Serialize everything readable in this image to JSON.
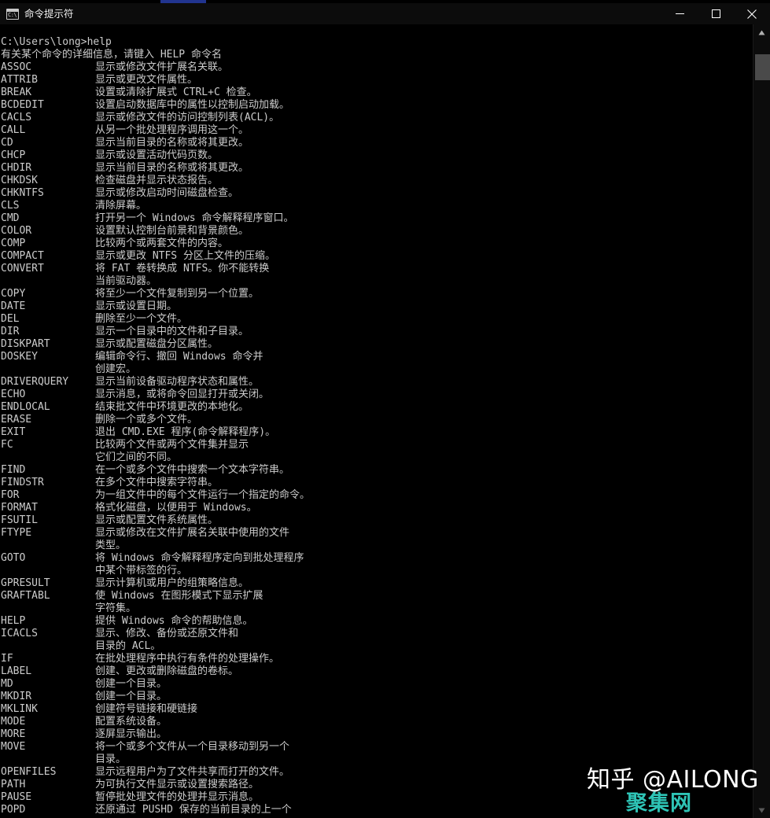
{
  "window": {
    "title": "命令提示符",
    "icon_glyph": "C:\\",
    "icon_name": "cmd-icon",
    "background_color": "#000000",
    "titlebar_color": "#0c0c0c",
    "text_color": "#cccccc",
    "controls": {
      "minimize_label": "–",
      "maximize_label": "□",
      "close_label": "×"
    }
  },
  "scrollbar": {
    "up_arrow_label": "▲",
    "down_arrow_label": "▼",
    "thumb_color": "#4a4a4a",
    "track_color": "#0c0c0c"
  },
  "watermarks": {
    "zhihu": "知乎 @AILONG",
    "site": "聚集网",
    "site_color": "#2ec4b6"
  },
  "console": {
    "prompt_line": "C:\\Users\\long>help",
    "header_line": "有关某个命令的详细信息，请键入 HELP 命令名",
    "lines": [
      {
        "cmd": "ASSOC",
        "desc": "显示或修改文件扩展名关联。"
      },
      {
        "cmd": "ATTRIB",
        "desc": "显示或更改文件属性。"
      },
      {
        "cmd": "BREAK",
        "desc": "设置或清除扩展式 CTRL+C 检查。"
      },
      {
        "cmd": "BCDEDIT",
        "desc": "设置启动数据库中的属性以控制启动加载。"
      },
      {
        "cmd": "CACLS",
        "desc": "显示或修改文件的访问控制列表(ACL)。"
      },
      {
        "cmd": "CALL",
        "desc": "从另一个批处理程序调用这一个。"
      },
      {
        "cmd": "CD",
        "desc": "显示当前目录的名称或将其更改。"
      },
      {
        "cmd": "CHCP",
        "desc": "显示或设置活动代码页数。"
      },
      {
        "cmd": "CHDIR",
        "desc": "显示当前目录的名称或将其更改。"
      },
      {
        "cmd": "CHKDSK",
        "desc": "检查磁盘并显示状态报告。"
      },
      {
        "cmd": "CHKNTFS",
        "desc": "显示或修改启动时间磁盘检查。"
      },
      {
        "cmd": "CLS",
        "desc": "清除屏幕。"
      },
      {
        "cmd": "CMD",
        "desc": "打开另一个 Windows 命令解释程序窗口。"
      },
      {
        "cmd": "COLOR",
        "desc": "设置默认控制台前景和背景颜色。"
      },
      {
        "cmd": "COMP",
        "desc": "比较两个或两套文件的内容。"
      },
      {
        "cmd": "COMPACT",
        "desc": "显示或更改 NTFS 分区上文件的压缩。"
      },
      {
        "cmd": "CONVERT",
        "desc": "将 FAT 卷转换成 NTFS。你不能转换"
      },
      {
        "cmd": "",
        "desc": "当前驱动器。"
      },
      {
        "cmd": "COPY",
        "desc": "将至少一个文件复制到另一个位置。"
      },
      {
        "cmd": "DATE",
        "desc": "显示或设置日期。"
      },
      {
        "cmd": "DEL",
        "desc": "删除至少一个文件。"
      },
      {
        "cmd": "DIR",
        "desc": "显示一个目录中的文件和子目录。"
      },
      {
        "cmd": "DISKPART",
        "desc": "显示或配置磁盘分区属性。"
      },
      {
        "cmd": "DOSKEY",
        "desc": "编辑命令行、撤回 Windows 命令并"
      },
      {
        "cmd": "",
        "desc": "创建宏。"
      },
      {
        "cmd": "DRIVERQUERY",
        "desc": "显示当前设备驱动程序状态和属性。"
      },
      {
        "cmd": "ECHO",
        "desc": "显示消息，或将命令回显打开或关闭。"
      },
      {
        "cmd": "ENDLOCAL",
        "desc": "结束批文件中环境更改的本地化。"
      },
      {
        "cmd": "ERASE",
        "desc": "删除一个或多个文件。"
      },
      {
        "cmd": "EXIT",
        "desc": "退出 CMD.EXE 程序(命令解释程序)。"
      },
      {
        "cmd": "FC",
        "desc": "比较两个文件或两个文件集并显示"
      },
      {
        "cmd": "",
        "desc": "它们之间的不同。"
      },
      {
        "cmd": "FIND",
        "desc": "在一个或多个文件中搜索一个文本字符串。"
      },
      {
        "cmd": "FINDSTR",
        "desc": "在多个文件中搜索字符串。"
      },
      {
        "cmd": "FOR",
        "desc": "为一组文件中的每个文件运行一个指定的命令。"
      },
      {
        "cmd": "FORMAT",
        "desc": "格式化磁盘，以便用于 Windows。"
      },
      {
        "cmd": "FSUTIL",
        "desc": "显示或配置文件系统属性。"
      },
      {
        "cmd": "FTYPE",
        "desc": "显示或修改在文件扩展名关联中使用的文件"
      },
      {
        "cmd": "",
        "desc": "类型。"
      },
      {
        "cmd": "GOTO",
        "desc": "将 Windows 命令解释程序定向到批处理程序"
      },
      {
        "cmd": "",
        "desc": "中某个带标签的行。"
      },
      {
        "cmd": "GPRESULT",
        "desc": "显示计算机或用户的组策略信息。"
      },
      {
        "cmd": "GRAFTABL",
        "desc": "使 Windows 在图形模式下显示扩展"
      },
      {
        "cmd": "",
        "desc": "字符集。"
      },
      {
        "cmd": "HELP",
        "desc": "提供 Windows 命令的帮助信息。"
      },
      {
        "cmd": "ICACLS",
        "desc": "显示、修改、备份或还原文件和"
      },
      {
        "cmd": "",
        "desc": "目录的 ACL。"
      },
      {
        "cmd": "IF",
        "desc": "在批处理程序中执行有条件的处理操作。"
      },
      {
        "cmd": "LABEL",
        "desc": "创建、更改或删除磁盘的卷标。"
      },
      {
        "cmd": "MD",
        "desc": "创建一个目录。"
      },
      {
        "cmd": "MKDIR",
        "desc": "创建一个目录。"
      },
      {
        "cmd": "MKLINK",
        "desc": "创建符号链接和硬链接"
      },
      {
        "cmd": "MODE",
        "desc": "配置系统设备。"
      },
      {
        "cmd": "MORE",
        "desc": "逐屏显示输出。"
      },
      {
        "cmd": "MOVE",
        "desc": "将一个或多个文件从一个目录移动到另一个"
      },
      {
        "cmd": "",
        "desc": "目录。"
      },
      {
        "cmd": "OPENFILES",
        "desc": "显示远程用户为了文件共享而打开的文件。"
      },
      {
        "cmd": "PATH",
        "desc": "为可执行文件显示或设置搜索路径。"
      },
      {
        "cmd": "PAUSE",
        "desc": "暂停批处理文件的处理并显示消息。"
      },
      {
        "cmd": "POPD",
        "desc": "还原通过 PUSHD 保存的当前目录的上一个"
      }
    ]
  }
}
